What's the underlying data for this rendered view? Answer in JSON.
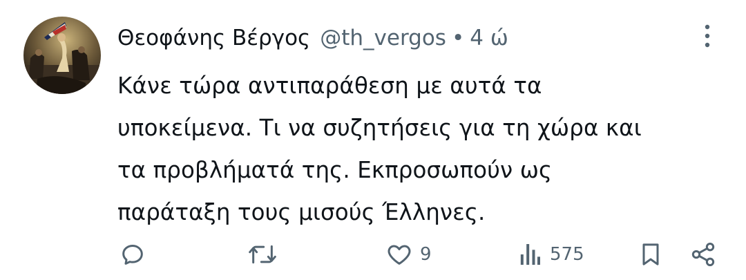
{
  "author": {
    "display_name": "Θεοφάνης Βέργος",
    "handle": "@th_vergos",
    "separator": "•",
    "timestamp": "4 ώ",
    "avatar_icon": "painting-avatar-icon"
  },
  "tweet": {
    "lines": [
      "Κάνε τώρα αντιπαράθεση με αυτά τα",
      "υποκείμενα. Τι να συζητήσεις για τη χώρα και",
      "τα προβλήματά της. Εκπροσωπούν ως",
      "παράταξη τους μισούς Έλληνες."
    ]
  },
  "actions": {
    "reply": {
      "icon": "reply-icon"
    },
    "retweet": {
      "icon": "retweet-icon"
    },
    "like": {
      "icon": "heart-icon",
      "count": "9"
    },
    "views": {
      "icon": "views-chart-icon",
      "count": "575"
    },
    "bookmark": {
      "icon": "bookmark-icon"
    },
    "share": {
      "icon": "share-icon"
    }
  },
  "colors": {
    "text": "#0f1419",
    "secondary": "#536471",
    "background": "#ffffff"
  }
}
